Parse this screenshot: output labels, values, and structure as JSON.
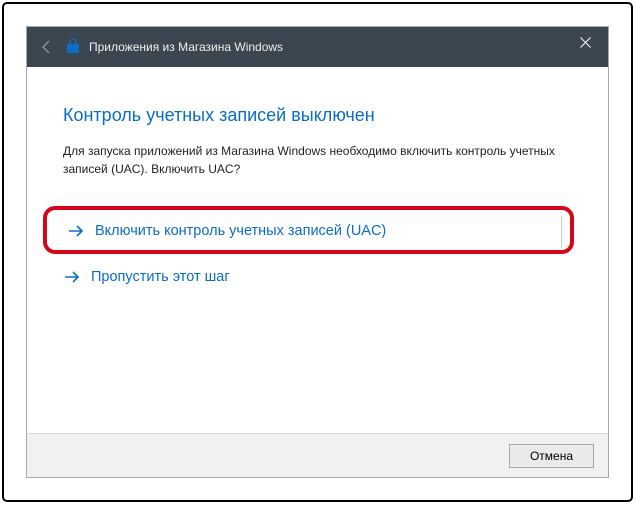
{
  "titlebar": {
    "title": "Приложения из Магазина Windows"
  },
  "main": {
    "heading": "Контроль учетных записей выключен",
    "description": "Для запуска приложений из Магазина Windows необходимо включить контроль учетных записей (UAC). Включить UAC?",
    "options": {
      "enable_uac": "Включить контроль учетных записей (UAC)",
      "skip": "Пропустить этот шаг"
    }
  },
  "footer": {
    "cancel": "Отмена"
  }
}
